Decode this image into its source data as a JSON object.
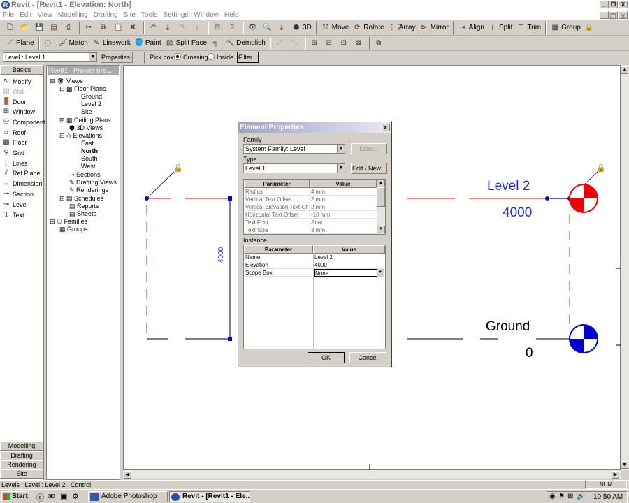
{
  "window": {
    "title": "Revit - [Revit1 - Elevation: North]",
    "min": "_",
    "restore": "❐",
    "close": "X"
  },
  "menu": [
    "File",
    "Edit",
    "View",
    "Modelling",
    "Drafting",
    "Site",
    "Tools",
    "Settings",
    "Window",
    "Help"
  ],
  "toolbar1": {
    "view3d": "3D",
    "move": "Move",
    "rotate": "Rotate",
    "array": "Array",
    "mirror": "Mirror",
    "align": "Align",
    "split": "Split",
    "trim": "Trim",
    "group": "Group"
  },
  "toolbar2": {
    "plane": "Plane",
    "match": "Match",
    "linework": "Linework",
    "paint": "Paint",
    "splitface": "Split Face",
    "demolish": "Demolish"
  },
  "optionsbar": {
    "selector": "Level : Level 1",
    "properties": "Properties...",
    "pickbox": "Pick box:",
    "crossing": "Crossing",
    "inside": "Inside",
    "filter": "Filter..."
  },
  "designbar": {
    "tabs_top": "Basics",
    "items": [
      "Modify",
      "Wall",
      "Door",
      "Window",
      "Component",
      "Roof",
      "Floor",
      "Grid",
      "Lines",
      "Ref Plane",
      "Dimension",
      "Section",
      "Level",
      "Text"
    ],
    "tabs_bottom": [
      "Modelling",
      "Drafting",
      "Rendering",
      "Site"
    ]
  },
  "browser": {
    "title": "Revit1 - Project bro...",
    "views": "Views",
    "floorplans": "Floor Plans",
    "fp": [
      "Ground",
      "Level 2",
      "Site"
    ],
    "ceiling": "Ceiling Plans",
    "v3d": "3D Views",
    "elevations": "Elevations",
    "elev": [
      "East",
      "North",
      "South",
      "West"
    ],
    "sections": "Sections",
    "drafting": "Drafting Views",
    "renderings": "Renderings",
    "schedules": "Schedules",
    "reports": "Reports",
    "sheets": "Sheets",
    "families": "Families",
    "groups": "Groups"
  },
  "canvas": {
    "level2_name": "Level 2",
    "level2_elev": "4000",
    "ground_name": "Ground",
    "ground_elev": "0",
    "dim": "4000"
  },
  "dialog": {
    "title": "Element Properties",
    "close": "x",
    "family_label": "Family",
    "family_value": "System Family: Level",
    "load": "Load...",
    "type_label": "Type",
    "type_value": "Level 1",
    "edit_new": "Edit / New...",
    "type_headers": [
      "Parameter",
      "Value"
    ],
    "type_params": [
      [
        "Radius",
        "4 mm"
      ],
      [
        "Vertical Text Offset",
        "2 mm"
      ],
      [
        "Vertical Elevation Text Off",
        "2 mm"
      ],
      [
        "Horizontal Text Offset",
        "-10 mm"
      ],
      [
        "Text Font",
        "Arial"
      ],
      [
        "Text Size",
        "3 mm"
      ]
    ],
    "instance_label": "Instance",
    "inst_headers": [
      "Parameter",
      "Value"
    ],
    "inst_params": [
      [
        "Name",
        "Level 2"
      ],
      [
        "Elevation",
        "4000"
      ],
      [
        "Scope Box",
        "None"
      ]
    ],
    "ok": "OK",
    "cancel": "Cancel"
  },
  "status": {
    "text": "Levels : Level : Level 2 : Control",
    "num": "NUM"
  },
  "taskbar": {
    "start": "Start",
    "tasks": [
      "Adobe Photoshop",
      "Revit - [Revit1 - Ele..."
    ],
    "clock": "10:50 AM"
  }
}
